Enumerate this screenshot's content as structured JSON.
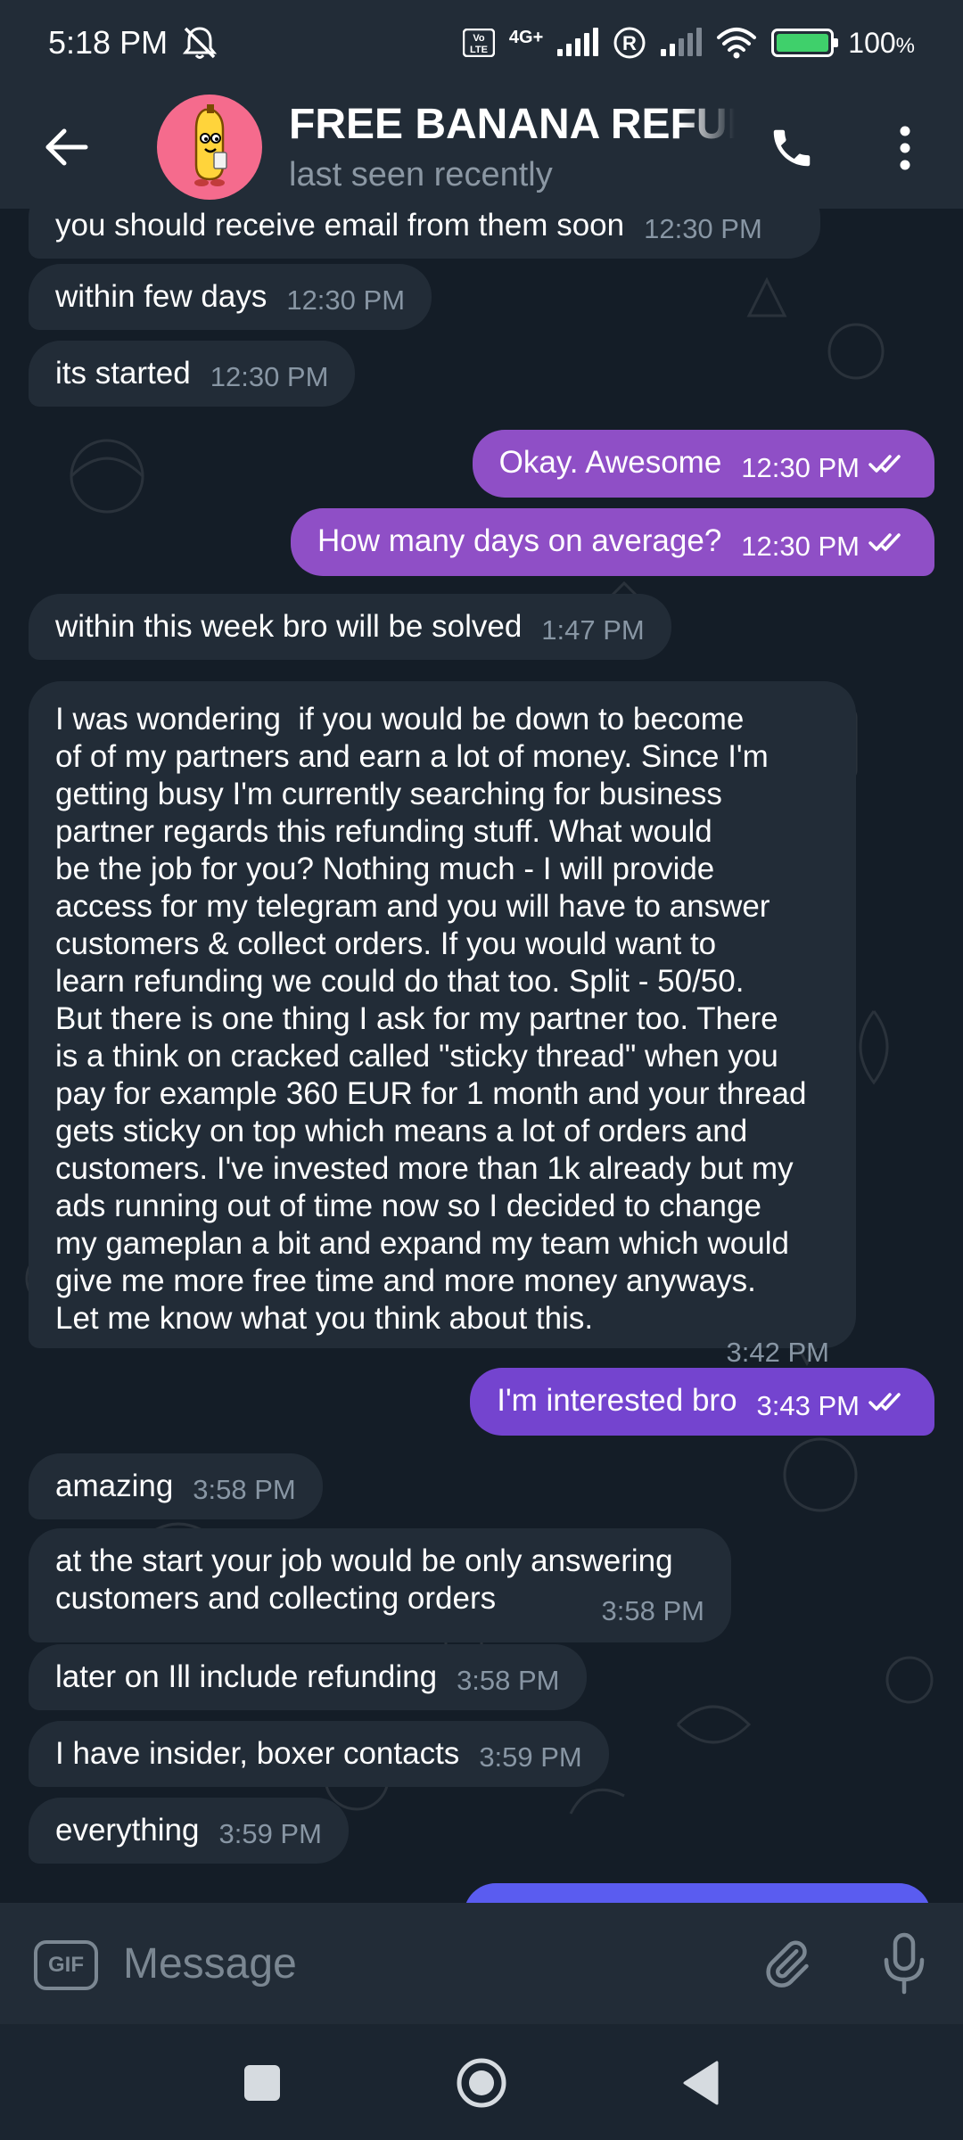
{
  "status_bar": {
    "time": "5:18 PM",
    "network": "4G+",
    "volte": "Vo LTE",
    "battery": "100",
    "battery_unit": "%"
  },
  "header": {
    "title": "FREE BANANA REFUNDS",
    "subtitle": "last seen recently"
  },
  "messages": [
    {
      "dir": "in",
      "text": "you should receive email from them soon",
      "time": "12:30 PM"
    },
    {
      "dir": "in",
      "text": "within few days",
      "time": "12:30 PM"
    },
    {
      "dir": "in",
      "text": "its started",
      "time": "12:30 PM"
    },
    {
      "dir": "out",
      "text": "Okay. Awesome",
      "time": "12:30 PM",
      "read": true
    },
    {
      "dir": "out",
      "text": "How many days on average?",
      "time": "12:30 PM",
      "read": true
    },
    {
      "dir": "in",
      "text": "within this week bro will be solved",
      "time": "1:47 PM"
    },
    {
      "dir": "in",
      "text": "I was wondering  if you would be down to become\nof of my partners and earn a lot of money. Since I'm\ngetting busy I'm currently searching for business\npartner regards this refunding stuff. What would\nbe the job for you? Nothing much - I will provide\naccess for my telegram and you will have to answer\ncustomers & collect orders. If you would want to\nlearn refunding we could do that too. Split - 50/50.\nBut there is one thing I ask for my partner too. There\nis a think on cracked called \"sticky thread\" when you\npay for example 360 EUR for 1 month and your thread\ngets sticky on top which means a lot of orders and\ncustomers. I've invested more than 1k already but my\nads running out of time now so I decided to change\nmy gameplan a bit and expand my team which would\ngive me more free time and more money anyways.\nLet me know what you think about this.",
      "time": "3:42 PM"
    },
    {
      "dir": "out",
      "text": "I'm interested bro",
      "time": "3:43 PM",
      "read": true
    },
    {
      "dir": "in",
      "text": "amazing",
      "time": "3:58 PM"
    },
    {
      "dir": "in",
      "text": "at the start your job would be only answering\ncustomers and collecting orders",
      "time": "3:58 PM"
    },
    {
      "dir": "in",
      "text": "later on Ill include refunding",
      "time": "3:58 PM"
    },
    {
      "dir": "in",
      "text": "I have insider, boxer contacts",
      "time": "3:59 PM"
    },
    {
      "dir": "in",
      "text": "everything",
      "time": "3:59 PM"
    }
  ],
  "input": {
    "placeholder": "Message",
    "gif_label": "GIF"
  },
  "icons": {
    "back": "arrow-left-icon",
    "call": "phone-icon",
    "more": "more-vertical-icon",
    "attach": "paperclip-icon",
    "mic": "microphone-icon",
    "nav_recents": "square-icon",
    "nav_home": "circle-icon",
    "nav_back": "triangle-icon"
  },
  "colors": {
    "outgoing_bubble": "#8f4fc6",
    "outgoing_bubble_alt": "#7444cf",
    "incoming_bubble": "#222c37",
    "chat_background": "#141d27",
    "avatar_background": "#f56b8d"
  }
}
